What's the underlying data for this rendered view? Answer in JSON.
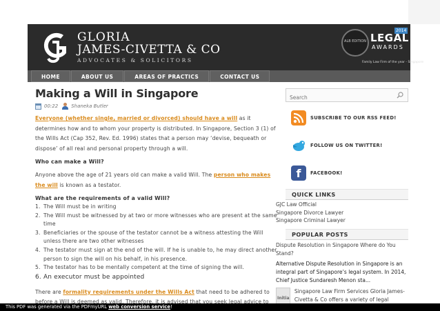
{
  "header": {
    "logo_line1": "GLORIA",
    "logo_line2": "JAMES-CIVETTA & CO",
    "logo_line3": "ADVOCATES & SOLICITORS",
    "award_seal": "ALB EDITION",
    "award_legal": "LEGAL",
    "award_year": "2014",
    "award_awards": "AWARDS",
    "award_sub": "Family Law Firm of the year - Singapore"
  },
  "nav": {
    "items": [
      {
        "label": "HOME"
      },
      {
        "label": "ABOUT US"
      },
      {
        "label": "AREAS OF PRACTICS"
      },
      {
        "label": "CONTACT US"
      }
    ]
  },
  "article": {
    "title": "Making a Will in Singapore",
    "time": "00:22",
    "author": "Shaneka Butler",
    "p1_link": "Everyone (whether single, married or divorced) should have a will",
    "p1_rest": " as it determines how and to whom your property is distributed. In Singapore, Section 3 (1) of the Wills Act (Cap 352, Rev. Ed. 1996) states that a person may ‘devise, bequeath or dispose’ of all real and personal property through a will.",
    "q1": "Who can make a Will?",
    "p2_start": "Anyone above the age of 21 years old can make a valid Will. The ",
    "p2_link": "person who makes the will",
    "p2_end": " is known as a testator.",
    "q2": "What are the requirements of a valid Will?",
    "requirements": [
      {
        "num": "1.",
        "text": "The Will must be in writing"
      },
      {
        "num": "2.",
        "text": "The Will must be witnessed by at two or more witnesses who are present at the same time"
      },
      {
        "num": "3.",
        "text": "Beneficiaries or the spouse of the testator cannot be a witness attesting the Will unless there are two other witnesses"
      },
      {
        "num": "4.",
        "text": "The testator must sign at the end of the will. If he is unable to, he may direct another person to sign the will on his behalf, in his presence."
      },
      {
        "num": "5.",
        "text": "The testator has to be mentally competent at the time of signing the will."
      },
      {
        "num": "6.",
        "text": "An executor must be appointed"
      }
    ],
    "p3_start": "There are ",
    "p3_link": "formality requirements under the Wills Act",
    "p3_end": " that need to be adhered to before a Will is deemed as valid. Therefore, it is advised that you seek legal advice to"
  },
  "sidebar": {
    "search_placeholder": "Search",
    "rss_label": "SUBSCRIBE TO OUR RSS FEED!",
    "twitter_label": "FOLLOW US ON TWITTER!",
    "facebook_label": "FACEBOOK!",
    "fb_glyph": "f",
    "quick_links_title": "QUICK LINKS",
    "quick_links": [
      {
        "label": "GJC Law Official"
      },
      {
        "label": "Singapore Divorce Lawyer"
      },
      {
        "label": "Singapore Criminal Lawyer"
      }
    ],
    "popular_title": "POPULAR POSTS",
    "popular": [
      {
        "text": "Dispute Resolution in Singapore Where do You Stand?"
      },
      {
        "text": "Alternative Dispute Resolution in Singapore is an integral part of Singapore’s legal system. In 2014, Chief Justice Sundaresh Menon sta..."
      }
    ],
    "thumb_label": "Initial consulta",
    "thumb_post": "Singapore Law Firm Services Gloria James-Civetta & Co offers a variety of legal services in"
  },
  "footer": {
    "prefix": "This PDF was generated via the PDFmyURL ",
    "link": "web conversion service",
    "suffix": "!"
  },
  "colors": {
    "banner": "#2b2b2b",
    "nav": "#5a5a5a",
    "link_orange": "#d98a1b",
    "rss": "#f28b22",
    "facebook": "#3b5998"
  }
}
